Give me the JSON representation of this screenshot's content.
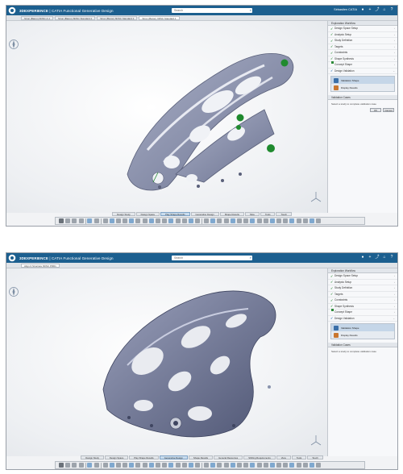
{
  "screens": [
    {
      "topbar": {
        "brand": "3DEXPERIENCE",
        "app_name": "CATIA Functional Generative Design",
        "search_value": "Search",
        "user": "Sébastien CATIA"
      },
      "doc_tabs": [
        "Struc (Baron) 6DSC.A.1",
        "Struc (Baron) 6DSC Standard.1",
        "Struc (Baron) 6DSC Standard.1",
        "Struc (Baron) 6DSC Standard.1"
      ],
      "panel": {
        "header": "Exploration Workflow",
        "steps": [
          "Design Space Setup",
          "Analysis Setup",
          "Study Definition",
          "Targets",
          "Constraints",
          "Shape Synthesis",
          "Concept Shape",
          "Design Validation"
        ],
        "sub_items": [
          "Validation Shape",
          "Display Results"
        ],
        "section2": "Validation Cases",
        "section2_text": "Select a study to complete validation case",
        "ok": "OK",
        "cancel": "Cancel"
      },
      "bottom_tabs": [
        "Design Study",
        "Design Space",
        "Play Shape Results",
        "Generative Design",
        "Shape Results",
        "Slice",
        "Tools",
        "Touch"
      ],
      "active_bottom_tab": 2
    },
    {
      "topbar": {
        "brand": "3DEXPERIENCE",
        "app_name": "CATIA Functional Generative Design",
        "search_value": "Search",
        "user": ""
      },
      "doc_tabs": [
        "Align 0 Structure 6DSC PRD1"
      ],
      "panel": {
        "header": "Exploration Workflow",
        "steps": [
          "Design Space Setup",
          "Analysis Setup",
          "Study Definition",
          "Targets",
          "Constraints",
          "Shape Synthesis",
          "Concept Shape",
          "Design Validation"
        ],
        "sub_items": [
          "Validation Shape",
          "Display Results"
        ],
        "section2": "Validation Cases",
        "section2_text": "Select a study to complete validation case",
        "ok": "",
        "cancel": ""
      },
      "bottom_tabs": [
        "Design Study",
        "Design Space",
        "Play Shape Results",
        "Generative Design",
        "Shape Results",
        "General Resources",
        "Shifting Requirements",
        "View",
        "Tools",
        "Touch"
      ],
      "active_bottom_tab": 3
    }
  ],
  "colors": {
    "topbar": "#1c5f8f",
    "part_body": "#8b92ab",
    "part_body_dark": "#5c6381",
    "fixture_green": "#1f8a2e",
    "check_green": "#2e8b3a"
  },
  "icons": [
    "compass-icon",
    "search-icon",
    "share-icon",
    "plus-icon",
    "user-icon",
    "home-icon",
    "help-icon",
    "axis-trihedron-icon"
  ]
}
